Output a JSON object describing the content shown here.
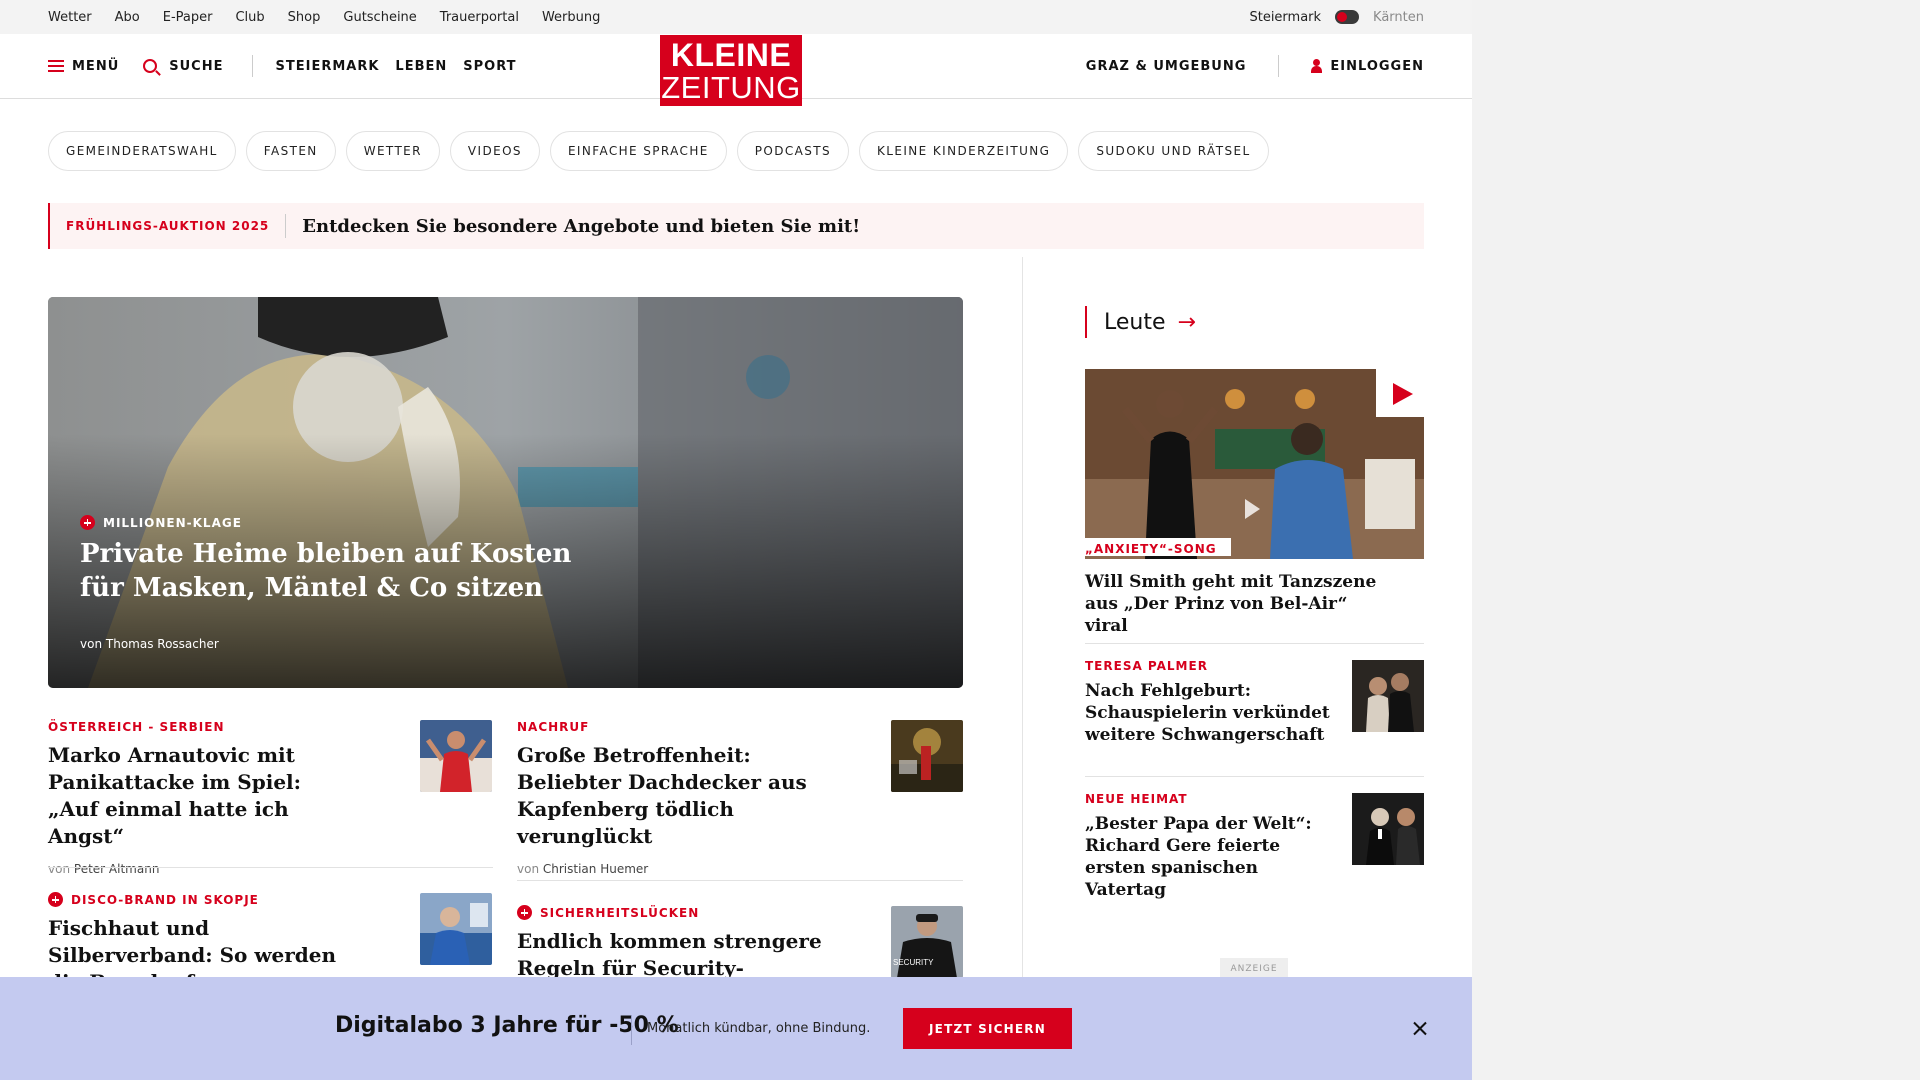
{
  "utility_nav": {
    "links": [
      "Wetter",
      "Abo",
      "E-Paper",
      "Club",
      "Shop",
      "Gutscheine",
      "Trauerportal",
      "Werbung"
    ],
    "region_active": "Steiermark",
    "region_inactive": "Kärnten"
  },
  "header": {
    "menu_label": "MENÜ",
    "search_label": "SUCHE",
    "nav": [
      "STEIERMARK",
      "LEBEN",
      "SPORT"
    ],
    "logo_line1": "KLEINE",
    "logo_line2": "ZEITUNG",
    "local_label": "GRAZ & UMGEBUNG",
    "login_label": "EINLOGGEN"
  },
  "topic_pills": [
    "GEMEINDERATSWAHL",
    "FASTEN",
    "WETTER",
    "VIDEOS",
    "EINFACHE SPRACHE",
    "PODCASTS",
    "KLEINE KINDERZEITUNG",
    "SUDOKU UND RÄTSEL"
  ],
  "promo": {
    "tag": "FRÜHLINGS-AUKTION 2025",
    "text": "Entdecken Sie besondere Angebote und bieten Sie mit!"
  },
  "hero": {
    "kicker": "MILLIONEN-KLAGE",
    "title": "Private Heime bleiben auf Kosten für Masken, Mäntel & Co sitzen",
    "author_prefix": "von",
    "author": "Thomas Rossacher"
  },
  "articles": [
    {
      "kicker": "ÖSTERREICH - SERBIEN",
      "headline": "Marko Arnautovic mit Panikattacke im Spiel: „Auf einmal hatte ich Angst“",
      "author_prefix": "von",
      "author": "Peter Altmann",
      "premium": false
    },
    {
      "kicker": "NACHRUF",
      "headline": "Große Betroffenheit: Beliebter Dachdecker aus Kapfenberg tödlich verunglückt",
      "author_prefix": "von",
      "author": "Christian Huemer",
      "premium": false
    },
    {
      "kicker": "DISCO-BRAND IN SKOPJE",
      "headline": "Fischhaut und Silberverband: So werden die Brandopfer",
      "premium": true
    },
    {
      "kicker": "SICHERHEITSLÜCKEN",
      "headline": "Endlich kommen strengere Regeln für Security-Mitarbeiter",
      "premium": true,
      "thumb_text": "SECURITY"
    }
  ],
  "sidebar": {
    "section_title": "Leute",
    "video_story": {
      "kicker": "„ANXIETY“-SONG",
      "headline": "Will Smith geht mit Tanzszene aus „Der Prinz von Bel-Air“ viral"
    },
    "stories": [
      {
        "kicker": "TERESA PALMER",
        "headline": "Nach Fehlgeburt: Schauspielerin verkündet weitere Schwangerschaft"
      },
      {
        "kicker": "NEUE HEIMAT",
        "headline": "„Bester Papa der Welt“: Richard Gere feierte ersten spanischen Vatertag"
      }
    ],
    "ad_label": "ANZEIGE"
  },
  "subscription_bar": {
    "title": "Digitalabo 3 Jahre für -50 %",
    "subtitle": "Monatlich kündbar, ohne Bindung.",
    "button": "JETZT SICHERN"
  },
  "colors": {
    "brand_red": "#d6001c",
    "bar_bg": "#c4caf0"
  }
}
